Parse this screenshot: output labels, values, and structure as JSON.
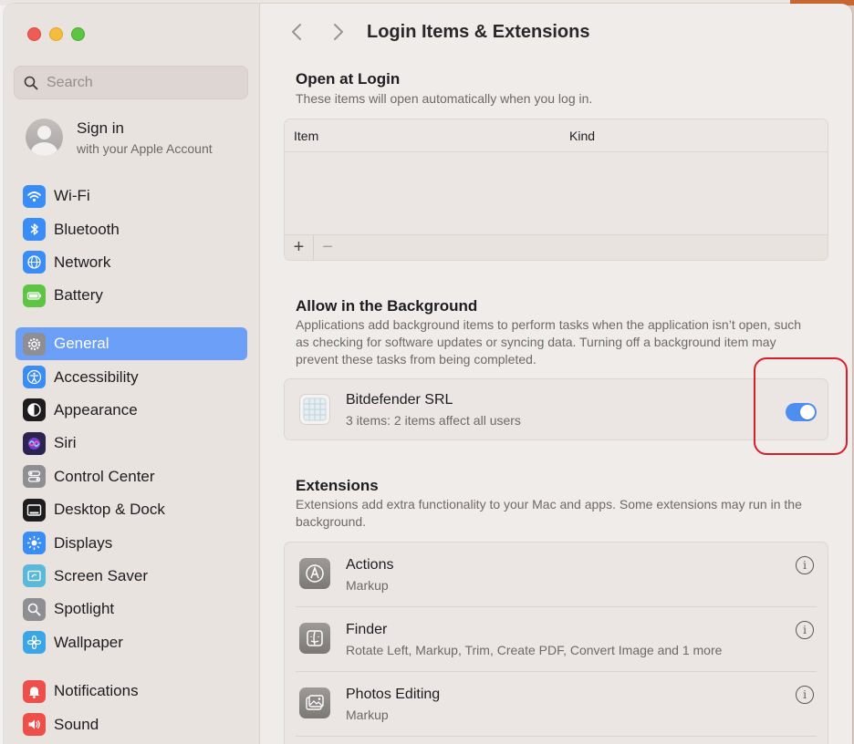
{
  "window": {
    "title": "Login Items & Extensions"
  },
  "search": {
    "placeholder": "Search"
  },
  "account": {
    "title": "Sign in",
    "subtitle": "with your Apple Account"
  },
  "sidebar": {
    "groups": [
      [
        {
          "id": "wifi",
          "label": "Wi-Fi",
          "icon": "wifi-icon",
          "color": "#3a8cf6"
        },
        {
          "id": "bluetooth",
          "label": "Bluetooth",
          "icon": "bluetooth-icon",
          "color": "#3a8cf6"
        },
        {
          "id": "network",
          "label": "Network",
          "icon": "globe-icon",
          "color": "#3a8cf6"
        },
        {
          "id": "battery",
          "label": "Battery",
          "icon": "battery-icon",
          "color": "#5ec443"
        }
      ],
      [
        {
          "id": "general",
          "label": "General",
          "icon": "gear-icon",
          "color": "#8e8e93",
          "active": true
        },
        {
          "id": "accessibility",
          "label": "Accessibility",
          "icon": "accessibility-icon",
          "color": "#3a8cf6"
        },
        {
          "id": "appearance",
          "label": "Appearance",
          "icon": "appearance-icon",
          "color": "#1d1d1f"
        },
        {
          "id": "siri",
          "label": "Siri",
          "icon": "siri-icon",
          "color": "#2b2350"
        },
        {
          "id": "control-center",
          "label": "Control Center",
          "icon": "control-center-icon",
          "color": "#8e8e93"
        },
        {
          "id": "desktop-dock",
          "label": "Desktop & Dock",
          "icon": "dock-icon",
          "color": "#1d1d1f"
        },
        {
          "id": "displays",
          "label": "Displays",
          "icon": "sun-icon",
          "color": "#3a8cf6"
        },
        {
          "id": "screen-saver",
          "label": "Screen Saver",
          "icon": "screen-saver-icon",
          "color": "#5ab8d8"
        },
        {
          "id": "spotlight",
          "label": "Spotlight",
          "icon": "magnifier-icon",
          "color": "#8e8e93"
        },
        {
          "id": "wallpaper",
          "label": "Wallpaper",
          "icon": "flower-icon",
          "color": "#3aa6e8"
        }
      ],
      [
        {
          "id": "notifications",
          "label": "Notifications",
          "icon": "bell-icon",
          "color": "#ee4f4a"
        },
        {
          "id": "sound",
          "label": "Sound",
          "icon": "speaker-icon",
          "color": "#ee4f4a"
        }
      ]
    ]
  },
  "open_at_login": {
    "title": "Open at Login",
    "description": "These items will open automatically when you log in.",
    "columns": [
      "Item",
      "Kind"
    ],
    "add_label": "+",
    "remove_label": "−"
  },
  "background": {
    "title": "Allow in the Background",
    "description": "Applications add background items to perform tasks when the application isn’t open, such as checking for software updates or syncing data. Turning off a background item may prevent these tasks from being completed.",
    "items": [
      {
        "name": "Bitdefender SRL",
        "detail": "3 items: 2 items affect all users",
        "enabled": true
      }
    ]
  },
  "extensions": {
    "title": "Extensions",
    "description": "Extensions add extra functionality to your Mac and apps. Some extensions may run in the background.",
    "items": [
      {
        "name": "Actions",
        "detail": "Markup",
        "icon": "markup-icon"
      },
      {
        "name": "Finder",
        "detail": "Rotate Left, Markup, Trim, Create PDF, Convert Image and 1 more",
        "icon": "finder-icon"
      },
      {
        "name": "Photos Editing",
        "detail": "Markup",
        "icon": "photos-icon"
      }
    ],
    "info_glyph": "i"
  },
  "colors": {
    "accent": "#4f8ef1",
    "sidebar_active": "#6c9ff7",
    "annotation": "#d81e2c"
  }
}
